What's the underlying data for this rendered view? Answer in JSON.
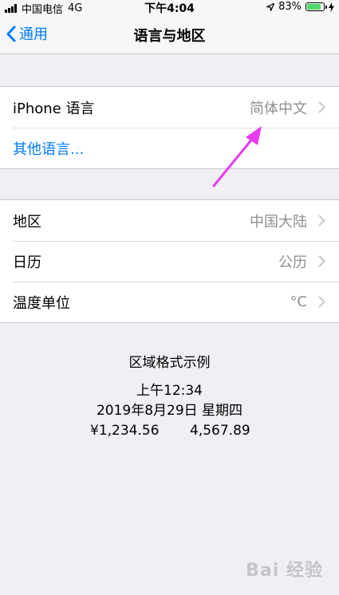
{
  "status_bar": {
    "carrier": "中国电信",
    "network": "4G",
    "time": "下午4:04",
    "battery_percent": "83%",
    "battery_level": 0.83
  },
  "nav": {
    "back_label": "通用",
    "title": "语言与地区"
  },
  "language_group": {
    "iphone_language_label": "iPhone 语言",
    "iphone_language_value": "简体中文",
    "other_languages_label": "其他语言..."
  },
  "region_group": {
    "region_label": "地区",
    "region_value": "中国大陆",
    "calendar_label": "日历",
    "calendar_value": "公历",
    "temperature_label": "温度单位",
    "temperature_value": "°C"
  },
  "format_example": {
    "heading": "区域格式示例",
    "time": "上午12:34",
    "date": "2019年8月29日 星期四",
    "currency": "¥1,234.56",
    "number": "4,567.89"
  },
  "watermark": "Bai 经验",
  "colors": {
    "accent": "#007aff",
    "annotation": "#e83cf0",
    "battery": "#4cd964"
  }
}
